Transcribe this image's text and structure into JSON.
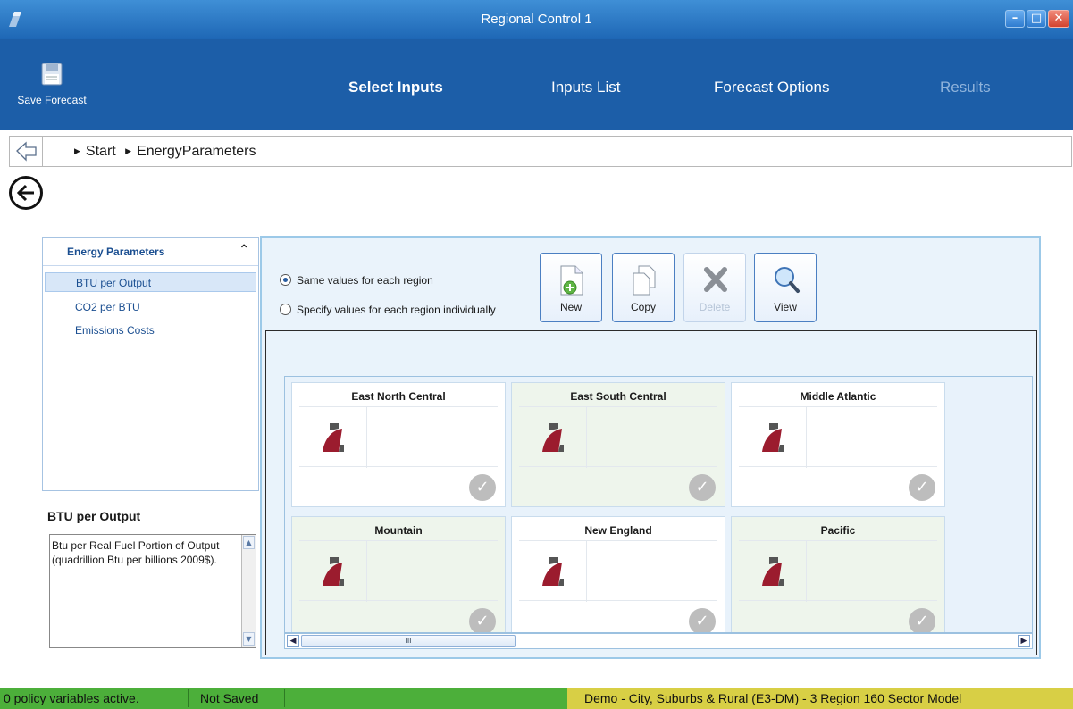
{
  "window": {
    "title": "Regional Control 1"
  },
  "ribbon": {
    "save_label": "Save Forecast",
    "tabs": {
      "select_inputs": "Select Inputs",
      "inputs_list": "Inputs List",
      "forecast_options": "Forecast Options",
      "results": "Results"
    }
  },
  "breadcrumb": {
    "start": "Start",
    "current": "EnergyParameters"
  },
  "left_panel": {
    "header": "Energy Parameters",
    "items": [
      "BTU per Output",
      "CO2 per BTU",
      "Emissions Costs"
    ]
  },
  "description": {
    "title": "BTU per Output",
    "text": "Btu per Real Fuel Portion of Output (quadrillion Btu per billions 2009$)."
  },
  "options": {
    "same_values": "Same values for each region",
    "individual_values": "Specify values for each region individually"
  },
  "toolbar": {
    "new": "New",
    "copy": "Copy",
    "delete": "Delete",
    "view": "View"
  },
  "regions": [
    "East North Central",
    "East South Central",
    "Middle Atlantic",
    "Mountain",
    "New England",
    "Pacific"
  ],
  "status": {
    "policy": "0 policy variables active.",
    "saved": "Not Saved",
    "model": "Demo - City, Suburbs & Rural (E3-DM) -  3 Region 160 Sector Model"
  },
  "colors": {
    "ribbon": "#1c5ea8",
    "status_green": "#4caf3a",
    "status_yellow": "#d8cf45",
    "link": "#1b4f91"
  }
}
